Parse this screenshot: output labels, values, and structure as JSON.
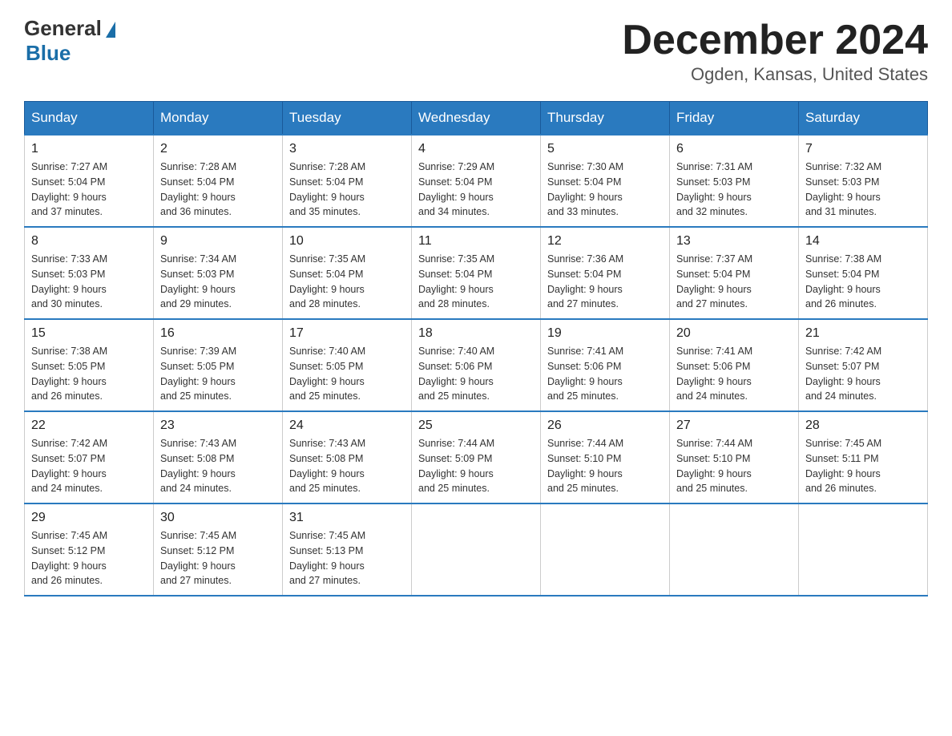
{
  "logo": {
    "general": "General",
    "blue": "Blue"
  },
  "title": "December 2024",
  "location": "Ogden, Kansas, United States",
  "days_of_week": [
    "Sunday",
    "Monday",
    "Tuesday",
    "Wednesday",
    "Thursday",
    "Friday",
    "Saturday"
  ],
  "weeks": [
    [
      {
        "day": "1",
        "sunrise": "7:27 AM",
        "sunset": "5:04 PM",
        "daylight": "9 hours and 37 minutes."
      },
      {
        "day": "2",
        "sunrise": "7:28 AM",
        "sunset": "5:04 PM",
        "daylight": "9 hours and 36 minutes."
      },
      {
        "day": "3",
        "sunrise": "7:28 AM",
        "sunset": "5:04 PM",
        "daylight": "9 hours and 35 minutes."
      },
      {
        "day": "4",
        "sunrise": "7:29 AM",
        "sunset": "5:04 PM",
        "daylight": "9 hours and 34 minutes."
      },
      {
        "day": "5",
        "sunrise": "7:30 AM",
        "sunset": "5:04 PM",
        "daylight": "9 hours and 33 minutes."
      },
      {
        "day": "6",
        "sunrise": "7:31 AM",
        "sunset": "5:03 PM",
        "daylight": "9 hours and 32 minutes."
      },
      {
        "day": "7",
        "sunrise": "7:32 AM",
        "sunset": "5:03 PM",
        "daylight": "9 hours and 31 minutes."
      }
    ],
    [
      {
        "day": "8",
        "sunrise": "7:33 AM",
        "sunset": "5:03 PM",
        "daylight": "9 hours and 30 minutes."
      },
      {
        "day": "9",
        "sunrise": "7:34 AM",
        "sunset": "5:03 PM",
        "daylight": "9 hours and 29 minutes."
      },
      {
        "day": "10",
        "sunrise": "7:35 AM",
        "sunset": "5:04 PM",
        "daylight": "9 hours and 28 minutes."
      },
      {
        "day": "11",
        "sunrise": "7:35 AM",
        "sunset": "5:04 PM",
        "daylight": "9 hours and 28 minutes."
      },
      {
        "day": "12",
        "sunrise": "7:36 AM",
        "sunset": "5:04 PM",
        "daylight": "9 hours and 27 minutes."
      },
      {
        "day": "13",
        "sunrise": "7:37 AM",
        "sunset": "5:04 PM",
        "daylight": "9 hours and 27 minutes."
      },
      {
        "day": "14",
        "sunrise": "7:38 AM",
        "sunset": "5:04 PM",
        "daylight": "9 hours and 26 minutes."
      }
    ],
    [
      {
        "day": "15",
        "sunrise": "7:38 AM",
        "sunset": "5:05 PM",
        "daylight": "9 hours and 26 minutes."
      },
      {
        "day": "16",
        "sunrise": "7:39 AM",
        "sunset": "5:05 PM",
        "daylight": "9 hours and 25 minutes."
      },
      {
        "day": "17",
        "sunrise": "7:40 AM",
        "sunset": "5:05 PM",
        "daylight": "9 hours and 25 minutes."
      },
      {
        "day": "18",
        "sunrise": "7:40 AM",
        "sunset": "5:06 PM",
        "daylight": "9 hours and 25 minutes."
      },
      {
        "day": "19",
        "sunrise": "7:41 AM",
        "sunset": "5:06 PM",
        "daylight": "9 hours and 25 minutes."
      },
      {
        "day": "20",
        "sunrise": "7:41 AM",
        "sunset": "5:06 PM",
        "daylight": "9 hours and 24 minutes."
      },
      {
        "day": "21",
        "sunrise": "7:42 AM",
        "sunset": "5:07 PM",
        "daylight": "9 hours and 24 minutes."
      }
    ],
    [
      {
        "day": "22",
        "sunrise": "7:42 AM",
        "sunset": "5:07 PM",
        "daylight": "9 hours and 24 minutes."
      },
      {
        "day": "23",
        "sunrise": "7:43 AM",
        "sunset": "5:08 PM",
        "daylight": "9 hours and 24 minutes."
      },
      {
        "day": "24",
        "sunrise": "7:43 AM",
        "sunset": "5:08 PM",
        "daylight": "9 hours and 25 minutes."
      },
      {
        "day": "25",
        "sunrise": "7:44 AM",
        "sunset": "5:09 PM",
        "daylight": "9 hours and 25 minutes."
      },
      {
        "day": "26",
        "sunrise": "7:44 AM",
        "sunset": "5:10 PM",
        "daylight": "9 hours and 25 minutes."
      },
      {
        "day": "27",
        "sunrise": "7:44 AM",
        "sunset": "5:10 PM",
        "daylight": "9 hours and 25 minutes."
      },
      {
        "day": "28",
        "sunrise": "7:45 AM",
        "sunset": "5:11 PM",
        "daylight": "9 hours and 26 minutes."
      }
    ],
    [
      {
        "day": "29",
        "sunrise": "7:45 AM",
        "sunset": "5:12 PM",
        "daylight": "9 hours and 26 minutes."
      },
      {
        "day": "30",
        "sunrise": "7:45 AM",
        "sunset": "5:12 PM",
        "daylight": "9 hours and 27 minutes."
      },
      {
        "day": "31",
        "sunrise": "7:45 AM",
        "sunset": "5:13 PM",
        "daylight": "9 hours and 27 minutes."
      },
      null,
      null,
      null,
      null
    ]
  ],
  "labels": {
    "sunrise": "Sunrise: ",
    "sunset": "Sunset: ",
    "daylight": "Daylight: "
  }
}
